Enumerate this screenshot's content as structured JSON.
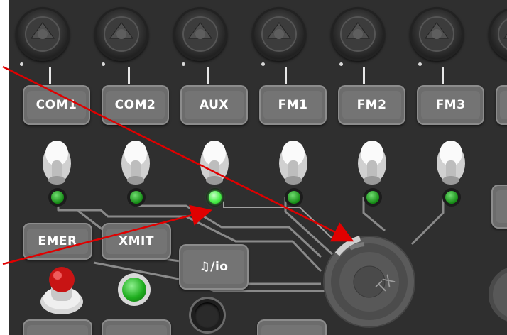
{
  "channels": [
    {
      "id": "com1",
      "label": "COM1",
      "led_on": false
    },
    {
      "id": "com2",
      "label": "COM2",
      "led_on": false
    },
    {
      "id": "aux",
      "label": "AUX",
      "led_on": true
    },
    {
      "id": "fm1",
      "label": "FM1",
      "led_on": false
    },
    {
      "id": "fm2",
      "label": "FM2",
      "led_on": false
    },
    {
      "id": "fm3",
      "label": "FM3",
      "led_on": false
    }
  ],
  "buttons": {
    "emer": "EMER",
    "xmit": "XMIT",
    "music_io": "♫/io"
  },
  "tx_knob": {
    "label": "TX"
  },
  "colors": {
    "panel": "#2f2f2f",
    "trace": "#8a8a8a",
    "led_green": "#1fae1f",
    "led_bright": "#4cf04c",
    "annotation_arrow": "#e00000",
    "emer_light": "#d01010"
  }
}
